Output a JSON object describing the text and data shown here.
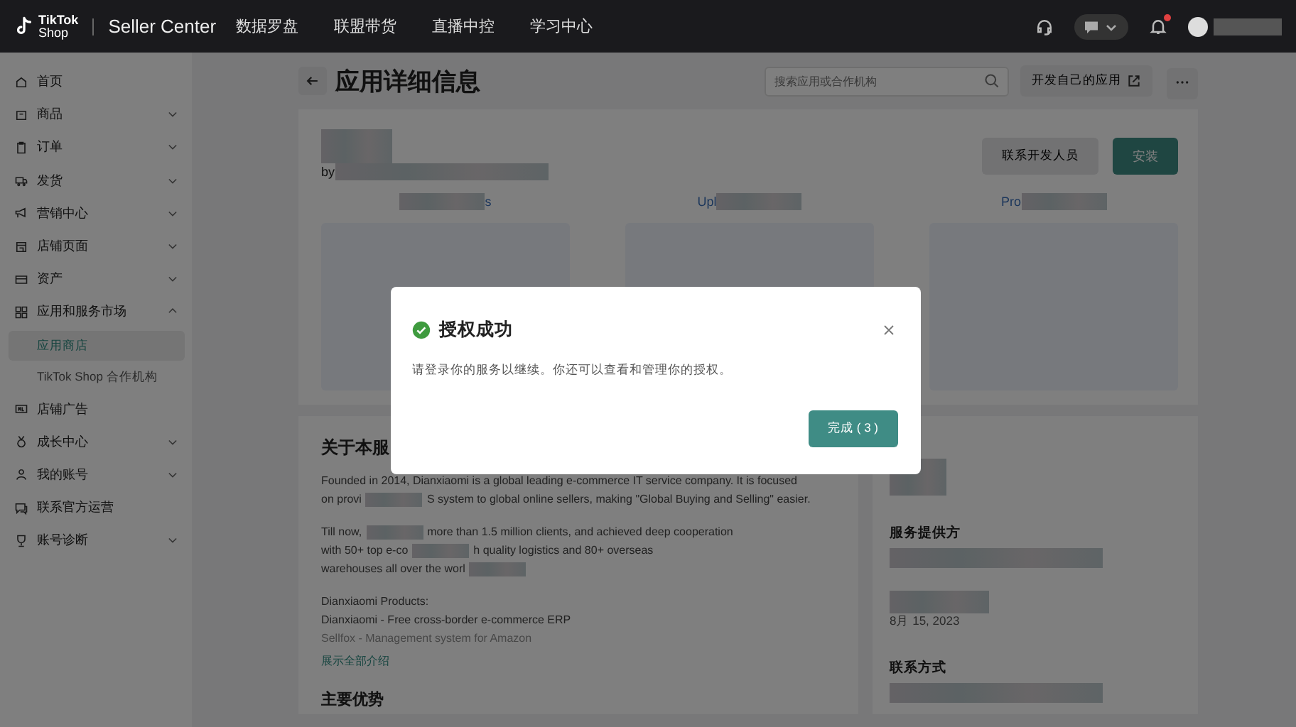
{
  "topbar": {
    "logo_top": "TikTok",
    "logo_bottom": "Shop",
    "product": "Seller Center",
    "nav": [
      "数据罗盘",
      "联盟带货",
      "直播中控",
      "学习中心"
    ],
    "notification_dot": true
  },
  "sidebar": {
    "items": [
      {
        "label": "首页",
        "kind": "link"
      },
      {
        "label": "商品",
        "kind": "group",
        "expanded": false
      },
      {
        "label": "订单",
        "kind": "group",
        "expanded": false
      },
      {
        "label": "发货",
        "kind": "group",
        "expanded": false
      },
      {
        "label": "营销中心",
        "kind": "group",
        "expanded": false
      },
      {
        "label": "店铺页面",
        "kind": "group",
        "expanded": false
      },
      {
        "label": "资产",
        "kind": "group",
        "expanded": false
      },
      {
        "label": "应用和服务市场",
        "kind": "group",
        "expanded": true,
        "children": [
          {
            "label": "应用商店",
            "selected": true
          },
          {
            "label": "TikTok Shop 合作机构",
            "selected": false
          }
        ]
      },
      {
        "label": "店铺广告",
        "kind": "link"
      },
      {
        "label": "成长中心",
        "kind": "group",
        "expanded": false
      },
      {
        "label": "我的账号",
        "kind": "group",
        "expanded": false
      },
      {
        "label": "联系官方运营",
        "kind": "link"
      },
      {
        "label": "账号诊断",
        "kind": "group",
        "expanded": false
      }
    ]
  },
  "page": {
    "title": "应用详细信息",
    "search": {
      "placeholder": "搜索应用或合作机构"
    },
    "dev_button": "开发自己的应用"
  },
  "app": {
    "by": "by",
    "contact_button": "联系开发人员",
    "install_button": "安装",
    "features": [
      {
        "heading": "s"
      },
      {
        "heading": "Upl"
      },
      {
        "heading": "Pro"
      }
    ]
  },
  "about": {
    "heading": "关于本服",
    "paragraphs": [
      {
        "lines": [
          {
            "parts": [
              "Founded in 2014, Dianxiaomi is a global leading e-commerce IT service company. It is focused"
            ]
          },
          {
            "parts": [
              "on provi",
              "S system to global online sellers, making \"Global Buying and Selling\" easier."
            ]
          }
        ]
      },
      {
        "lines": [
          {
            "parts": [
              "Till now,",
              "more than 1.5 million clients, and achieved deep cooperation"
            ]
          },
          {
            "parts": [
              "with 50+ top e-co",
              "h quality logistics and 80+ overseas"
            ]
          },
          {
            "parts": [
              "warehouses all over the worl"
            ],
            "trailing_redaction": true
          }
        ]
      }
    ],
    "products_heading": "Dianxiaomi Products:",
    "products": [
      {
        "text": "Dianxiaomi - Free cross-border e-commerce ERP",
        "faded": false
      },
      {
        "text": "Sellfox - Management system for Amazon",
        "faded": true
      }
    ],
    "more_link": "展示全部介绍"
  },
  "advantages_heading": "主要优势",
  "aside": {
    "provider_heading": "服务提供方",
    "date": "8月 15, 2023",
    "contact_heading": "联系方式"
  },
  "modal": {
    "title": "授权成功",
    "message": "请登录你的服务以继续。你还可以查看和管理你的授权。",
    "confirm": "完成 ( 3 )"
  }
}
